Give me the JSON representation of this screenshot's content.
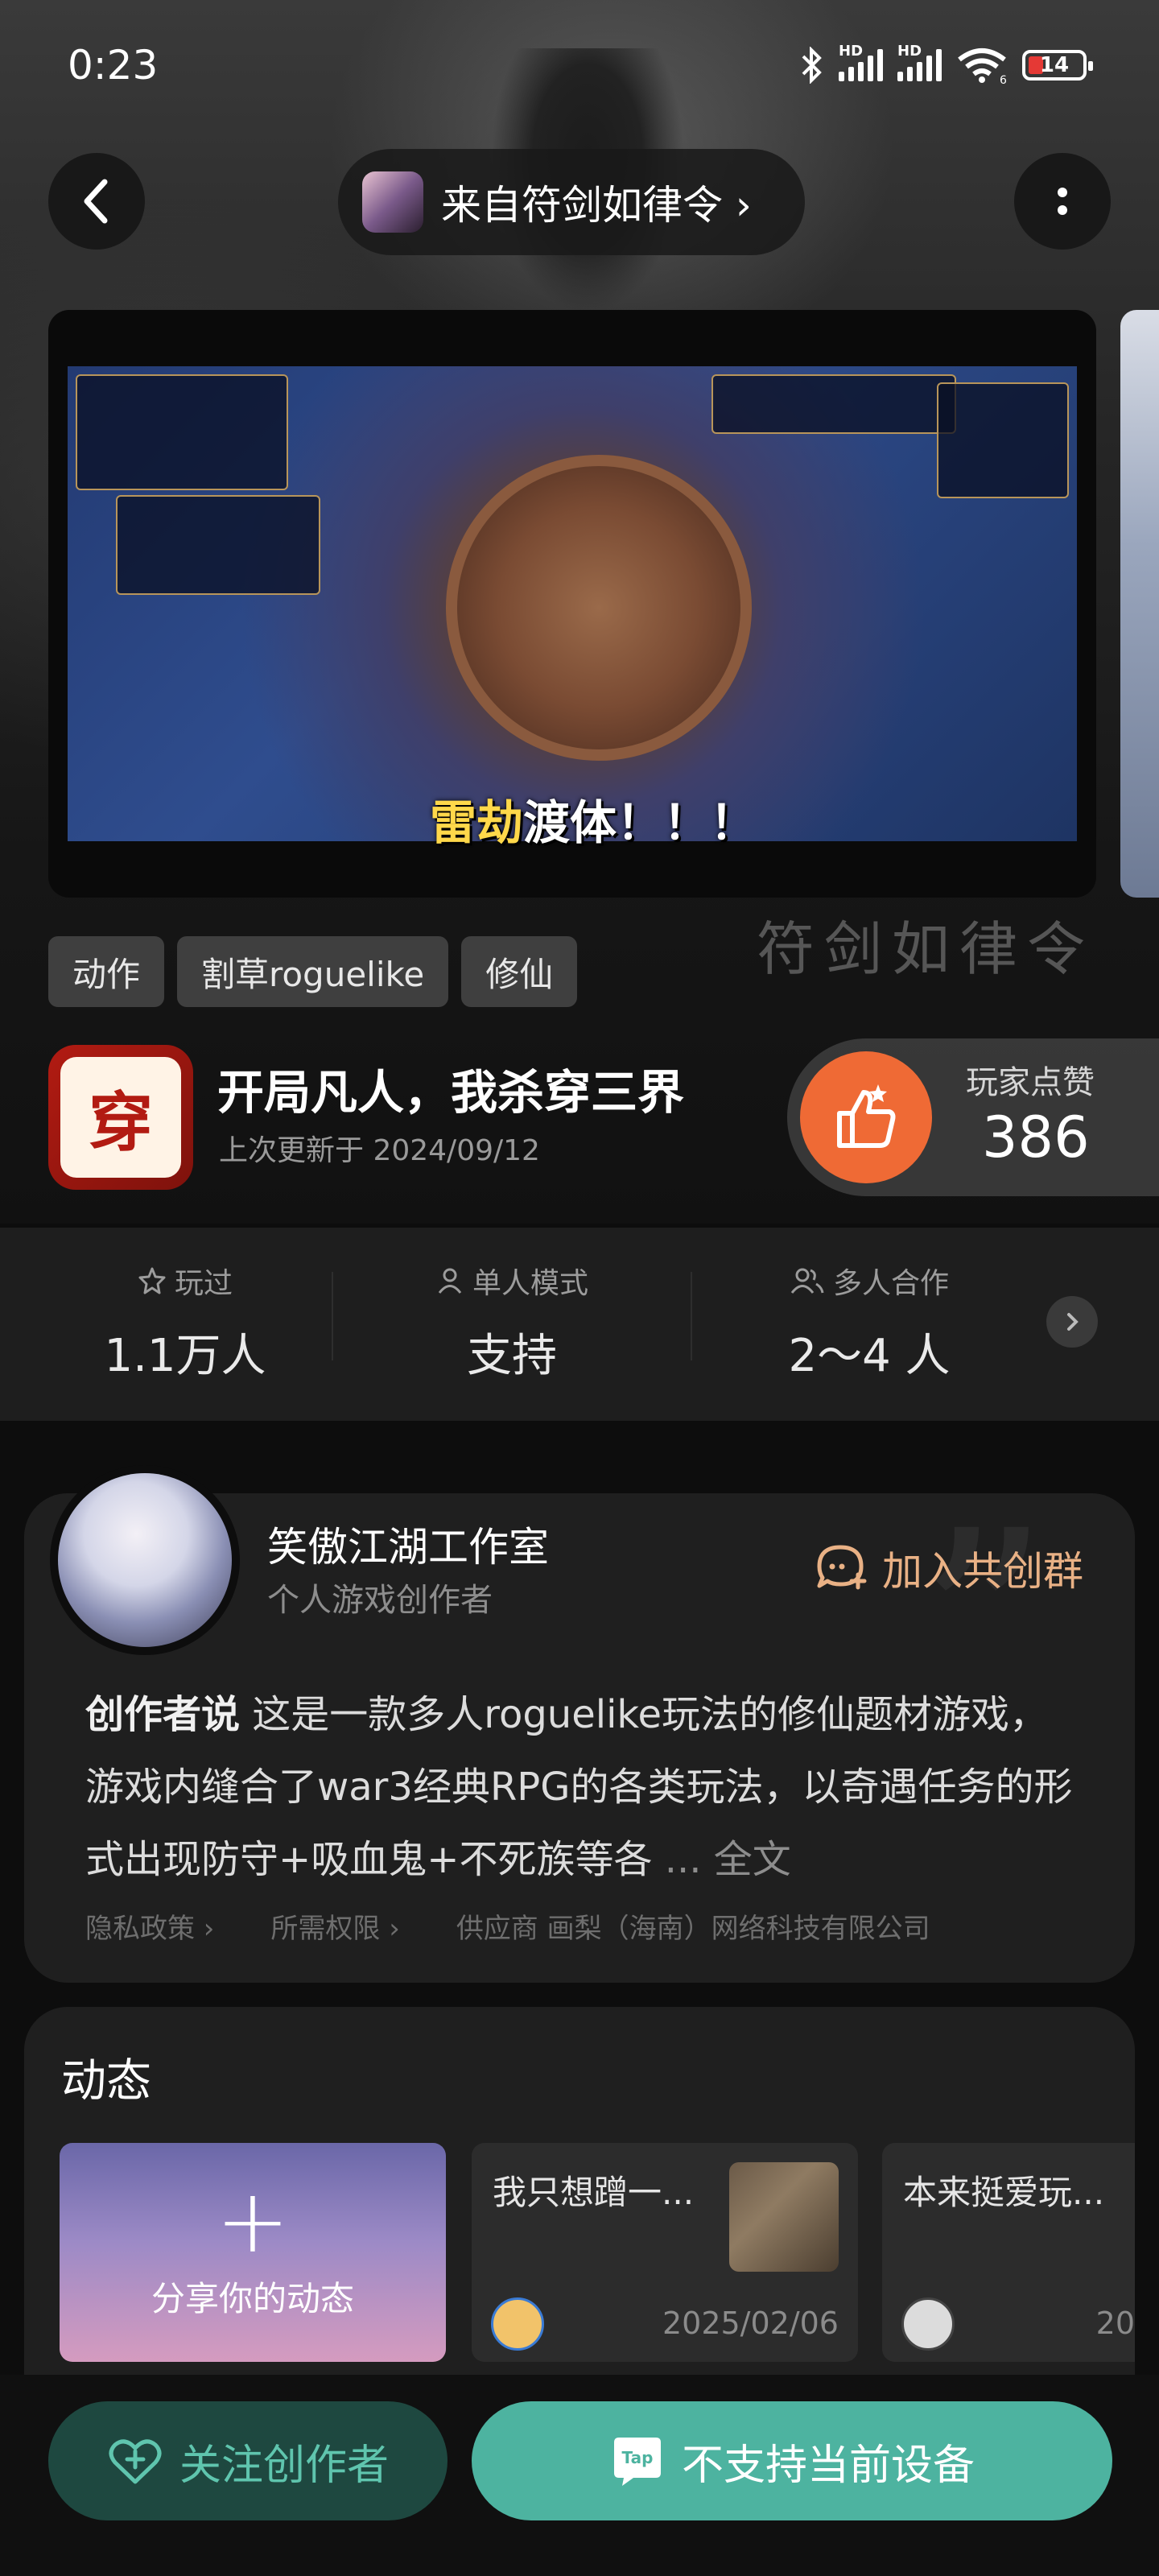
{
  "status_bar": {
    "time": "0:23",
    "battery": "14",
    "net1": "HD",
    "net2": "HD",
    "wifi_num": "6"
  },
  "nav": {
    "source_text": "来自符剑如律令 ›"
  },
  "media": {
    "subtitle_prefix": "雷劫",
    "subtitle_rest": "渡体！！！",
    "watermark": "符剑如律令"
  },
  "tags": [
    "动作",
    "割草roguelike",
    "修仙"
  ],
  "game": {
    "icon_text": "穿",
    "title": "开局凡人，我杀穿三界",
    "updated": "上次更新于 2024/09/12",
    "likes_label": "玩家点赞",
    "likes_count": "386"
  },
  "stats": {
    "played_label": "玩过",
    "played_value": "1.1万人",
    "single_label": "单人模式",
    "single_value": "支持",
    "multi_label": "多人合作",
    "multi_value": "2～4 人"
  },
  "creator": {
    "name": "笑傲江湖工作室",
    "role": "个人游戏创作者",
    "join_label": "加入共创群",
    "desc_title": "创作者说",
    "desc_body": " 这是一款多人roguelike玩法的修仙题材游戏，游戏内缝合了war3经典RPG的各类玩法，以奇遇任务的形式出现防守+吸血鬼+不死族等各",
    "desc_more": " ... 全文",
    "privacy": "隐私政策 ›",
    "permissions": "所需权限 ›",
    "provider": "供应商 画梨（海南）网络科技有限公司"
  },
  "dynamics": {
    "title": "动态",
    "share_label": "分享你的动态",
    "posts": [
      {
        "title": "我只想蹭一...",
        "date": "2025/02/06"
      },
      {
        "title": "本来挺爱玩...",
        "date": "20"
      }
    ]
  },
  "bottom": {
    "follow_label": "关注创作者",
    "unsupported_label": "不支持当前设备"
  },
  "colors": {
    "accent": "#4db3a0",
    "like": "#ef6a35",
    "join": "#e9b185"
  }
}
